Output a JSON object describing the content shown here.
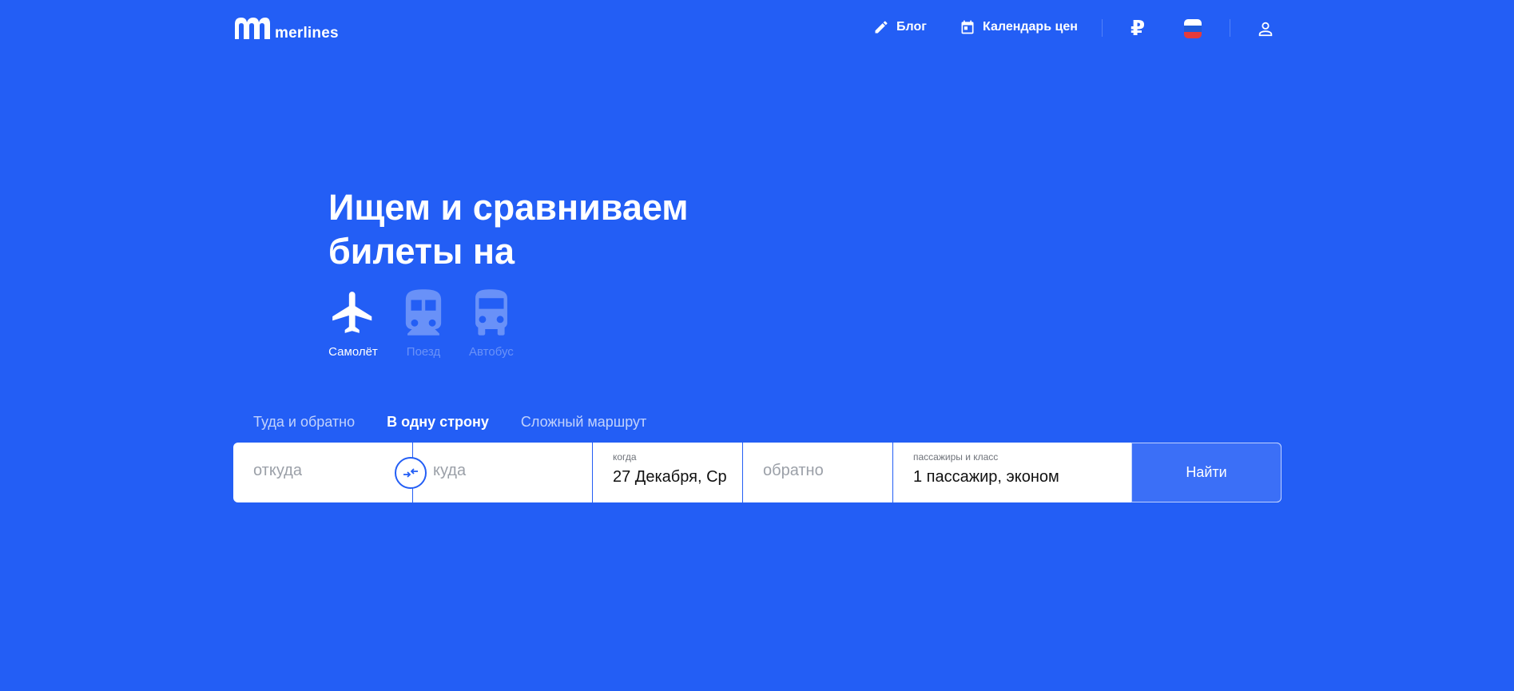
{
  "header": {
    "logo_text": "merlines",
    "nav": [
      {
        "label": "Блог",
        "icon": "pencil-icon"
      },
      {
        "label": "Календарь цен",
        "icon": "calendar-icon"
      }
    ],
    "currency_symbol": "₽",
    "language_flag": "russia-flag-icon",
    "profile_icon": "user-icon"
  },
  "hero": {
    "title_line1": "Ищем и сравниваем",
    "title_line2": "билеты на"
  },
  "modes": [
    {
      "label": "Самолёт",
      "icon": "airplane-icon",
      "active": true
    },
    {
      "label": "Поезд",
      "icon": "train-icon",
      "active": false
    },
    {
      "label": "Автобус",
      "icon": "bus-icon",
      "active": false
    }
  ],
  "trip_tabs": [
    {
      "label": "Туда и обратно",
      "active": false
    },
    {
      "label": "В одну строну",
      "active": true
    },
    {
      "label": "Сложный маршрут",
      "active": false
    }
  ],
  "search": {
    "from_placeholder": "откуда",
    "to_placeholder": "куда",
    "date_label": "когда",
    "date_value": "27 Декабря, Ср",
    "return_placeholder": "обратно",
    "passengers_label": "пассажиры и класс",
    "passengers_value": "1 пассажир, эконом",
    "submit_label": "Найти"
  },
  "colors": {
    "background": "#235ef5",
    "search_button": "#3b6ff7"
  }
}
